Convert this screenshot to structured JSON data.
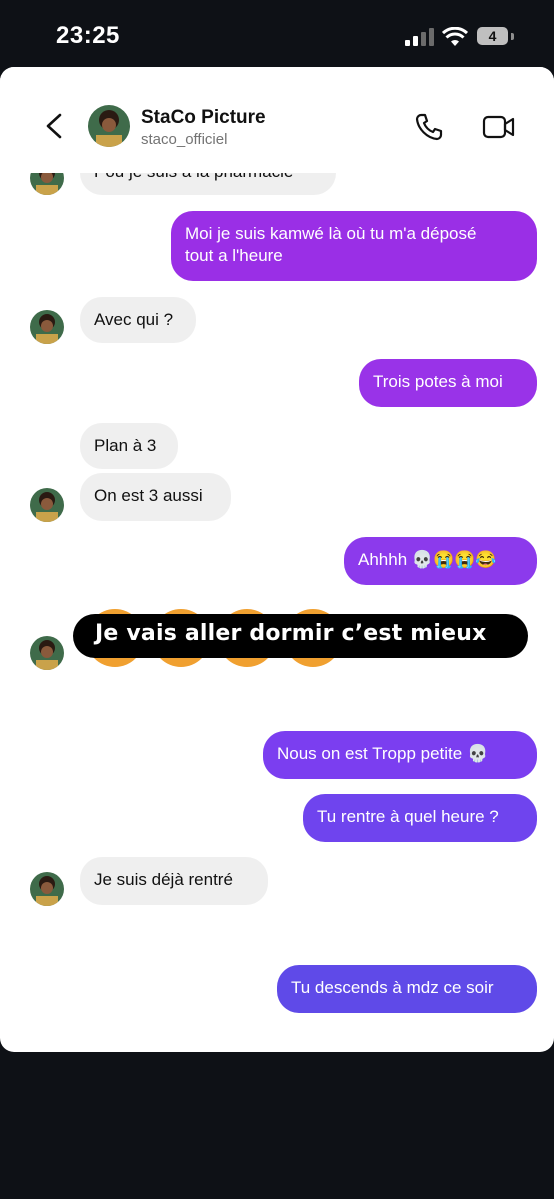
{
  "status_bar": {
    "time": "23:25",
    "battery": "4"
  },
  "header": {
    "name": "StaCo Picture",
    "username": "staco_officiel"
  },
  "messages": {
    "m0": "Pou je suis à la pharmacie",
    "m1_line1": "Moi je suis kamwé là où tu m'a déposé",
    "m1_line2": "tout a l'heure",
    "m2": "Avec qui ?",
    "m3": "Trois potes à moi",
    "m4": "Plan à 3",
    "m5": "On est 3 aussi",
    "m6": "Ahhhh 💀😭😭😂",
    "m7": "Nous on est Tropp petite 💀",
    "m8": "Tu rentre à quel heure ?",
    "m9": "Je suis déjà rentré",
    "m10": "Tu descends à mdz ce soir"
  },
  "overlay_caption": "Je vais aller dormir c’est mieux",
  "colors": {
    "purple_light": "#9a2fe6",
    "purple_mid": "#7b3ef0",
    "purple_dark": "#5f4ae8",
    "incoming_bg": "#efefef"
  }
}
